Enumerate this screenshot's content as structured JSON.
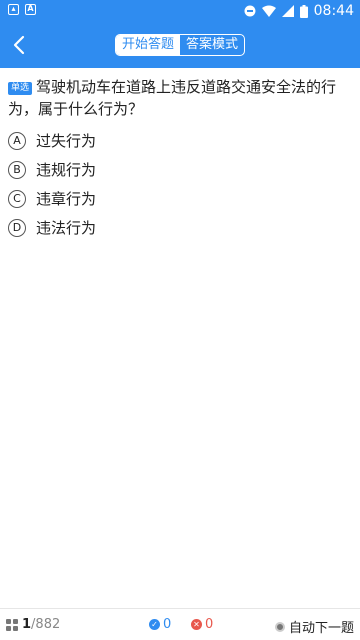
{
  "status_bar": {
    "time": "08:44"
  },
  "header": {
    "tabs": [
      {
        "label": "开始答题",
        "active": true
      },
      {
        "label": "答案模式",
        "active": false
      }
    ]
  },
  "question": {
    "type_badge": "单选",
    "text": "驾驶机动车在道路上违反道路交通安全法的行为，属于什么行为？",
    "options": [
      {
        "letter": "A",
        "text": "过失行为"
      },
      {
        "letter": "B",
        "text": "违规行为"
      },
      {
        "letter": "C",
        "text": "违章行为"
      },
      {
        "letter": "D",
        "text": "违法行为"
      }
    ]
  },
  "footer": {
    "current": "1",
    "total": "/882",
    "correct_count": "0",
    "wrong_count": "0",
    "auto_next_label": "自动下一题"
  },
  "colors": {
    "accent": "#2f8cf0",
    "wrong": "#e8584d"
  }
}
